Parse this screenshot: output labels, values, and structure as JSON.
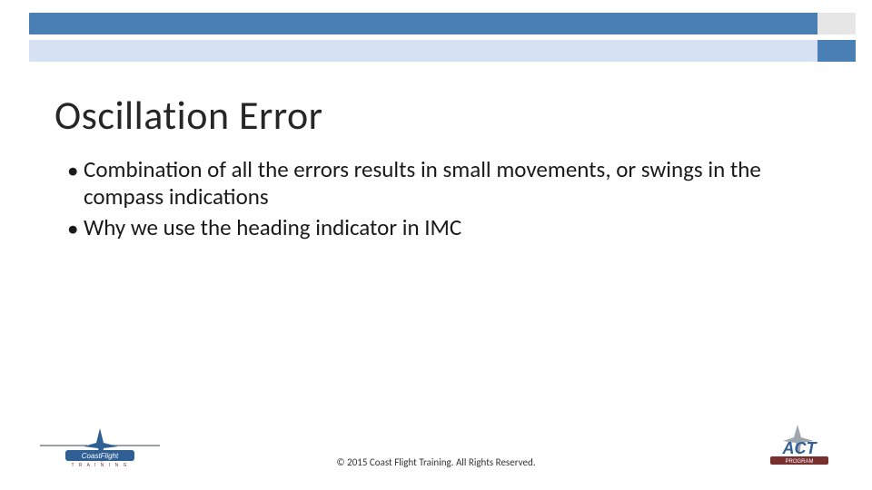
{
  "slide": {
    "title": "Oscillation Error",
    "bullets": [
      "Combination of all the errors results in small movements, or swings in the compass indications",
      "Why we use the heading indicator in IMC"
    ],
    "footer": "© 2015 Coast Flight Training. All Rights Reserved."
  },
  "theme": {
    "accent_dark": "#4a7fb5",
    "accent_light": "#d6e2f4",
    "grey_block": "#e6e6e6"
  },
  "logos": {
    "left_name": "Coast Flight Training",
    "right_name": "ACT Program"
  }
}
